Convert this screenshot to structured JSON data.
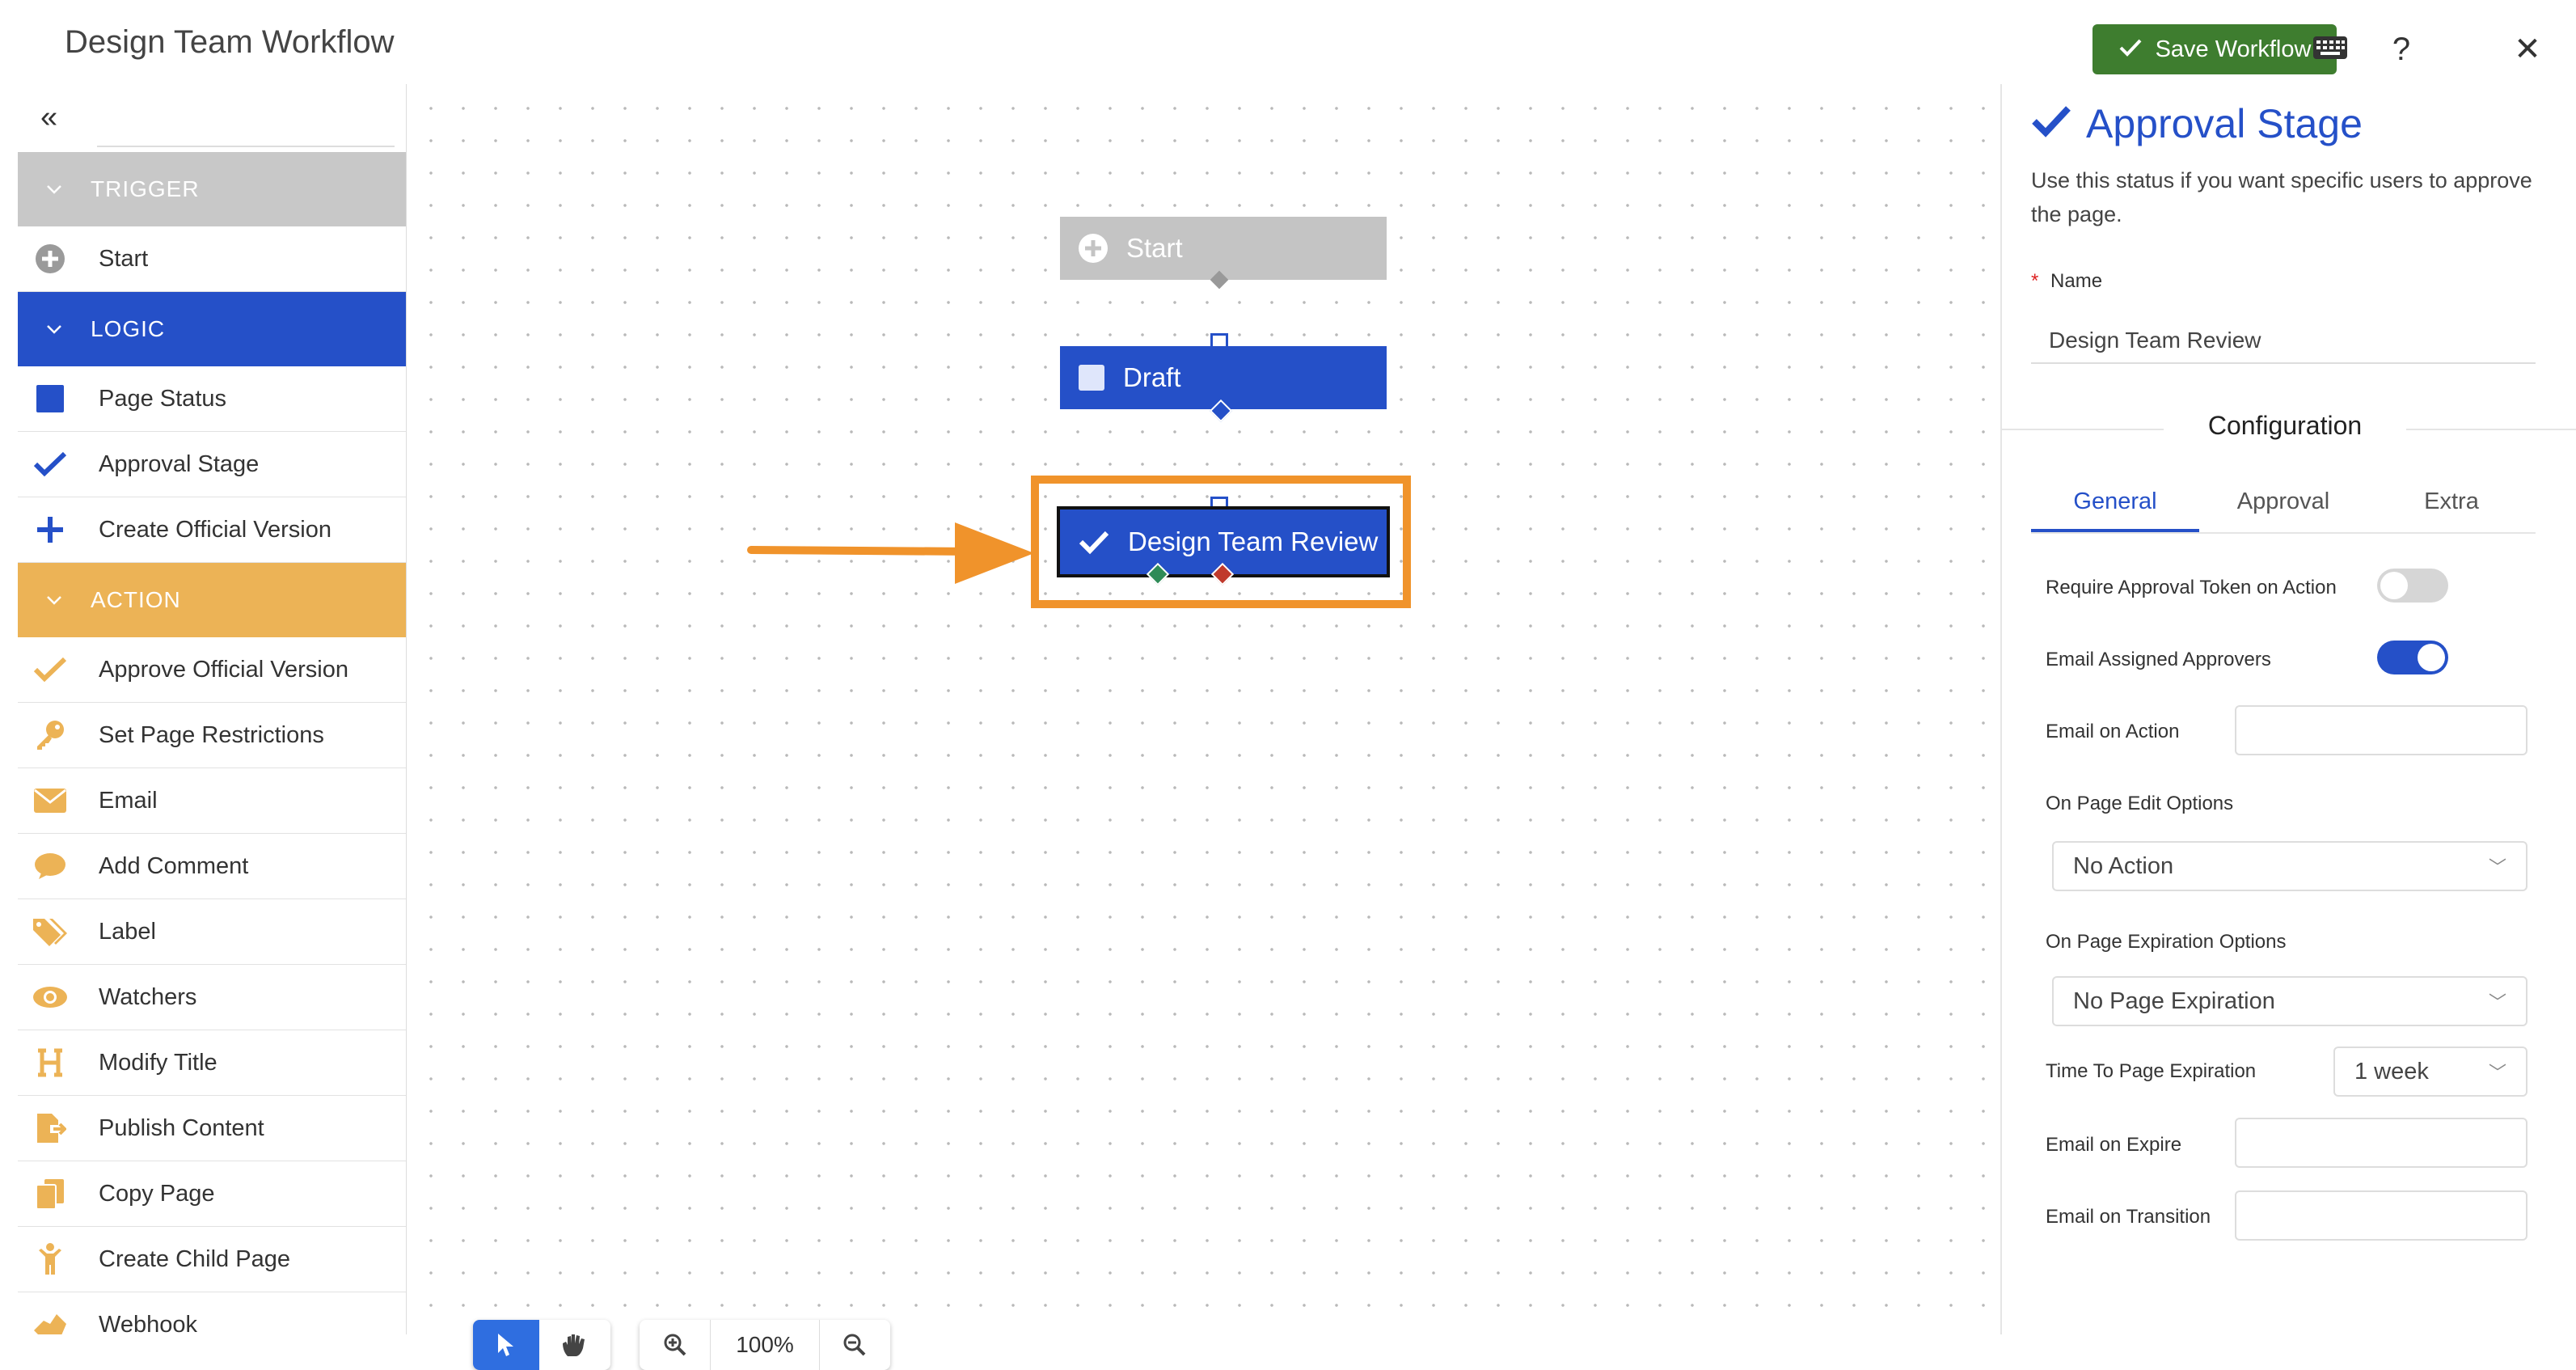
{
  "header": {
    "title": "Design Team Workflow",
    "save_label": "Save Workflow",
    "icons": [
      "keyboard-icon",
      "help-icon",
      "close-icon"
    ],
    "help_glyph": "?",
    "close_glyph": "✕"
  },
  "sidebar": {
    "collapse_glyph": "«",
    "sections": [
      {
        "label": "TRIGGER",
        "color": "#c8c8c8",
        "items": [
          {
            "label": "Start",
            "icon": "plus-circle-icon"
          }
        ]
      },
      {
        "label": "LOGIC",
        "color": "#2550c8",
        "items": [
          {
            "label": "Page Status",
            "icon": "square-icon"
          },
          {
            "label": "Approval Stage",
            "icon": "check-icon"
          },
          {
            "label": "Create Official Version",
            "icon": "plus-icon"
          }
        ]
      },
      {
        "label": "ACTION",
        "color": "#ecb356",
        "items": [
          {
            "label": "Approve Official Version",
            "icon": "check-icon"
          },
          {
            "label": "Set Page Restrictions",
            "icon": "key-icon"
          },
          {
            "label": "Email",
            "icon": "envelope-icon"
          },
          {
            "label": "Add Comment",
            "icon": "comment-icon"
          },
          {
            "label": "Label",
            "icon": "tags-icon"
          },
          {
            "label": "Watchers",
            "icon": "eye-icon"
          },
          {
            "label": "Modify Title",
            "icon": "heading-icon"
          },
          {
            "label": "Publish Content",
            "icon": "publish-icon"
          },
          {
            "label": "Copy Page",
            "icon": "copy-icon"
          },
          {
            "label": "Create Child Page",
            "icon": "child-icon"
          },
          {
            "label": "Webhook",
            "icon": "webhook-icon"
          }
        ]
      }
    ]
  },
  "canvas": {
    "nodes": {
      "start": "Start",
      "draft": "Draft",
      "review": "Design Team Review"
    },
    "zoom": "100%",
    "tools": [
      "pointer-icon",
      "hand-icon",
      "zoom-in-icon",
      "zoom-out-icon"
    ],
    "colors": {
      "highlight": "#f0932b",
      "logic": "#2550c8",
      "trigger": "#c4c4c4"
    }
  },
  "panel": {
    "title": "Approval Stage",
    "description": "Use this status if you want specific users to approve the page.",
    "name_label": "Name",
    "name_required": "*",
    "name_value": "Design Team Review",
    "config_heading": "Configuration",
    "tabs": [
      "General",
      "Approval",
      "Extra"
    ],
    "active_tab": "General",
    "require_token_label": "Require Approval Token on Action",
    "require_token_on": false,
    "email_assigned_label": "Email Assigned Approvers",
    "email_assigned_on": true,
    "email_on_action_label": "Email on Action",
    "page_edit_label": "On Page Edit Options",
    "page_edit_value": "No Action",
    "page_expiration_label": "On Page Expiration Options",
    "page_expiration_value": "No Page Expiration",
    "time_to_expiration_label": "Time To Page Expiration",
    "time_to_expiration_value": "1 week",
    "email_on_expire_label": "Email on Expire",
    "email_on_transition_label": "Email on Transition"
  }
}
